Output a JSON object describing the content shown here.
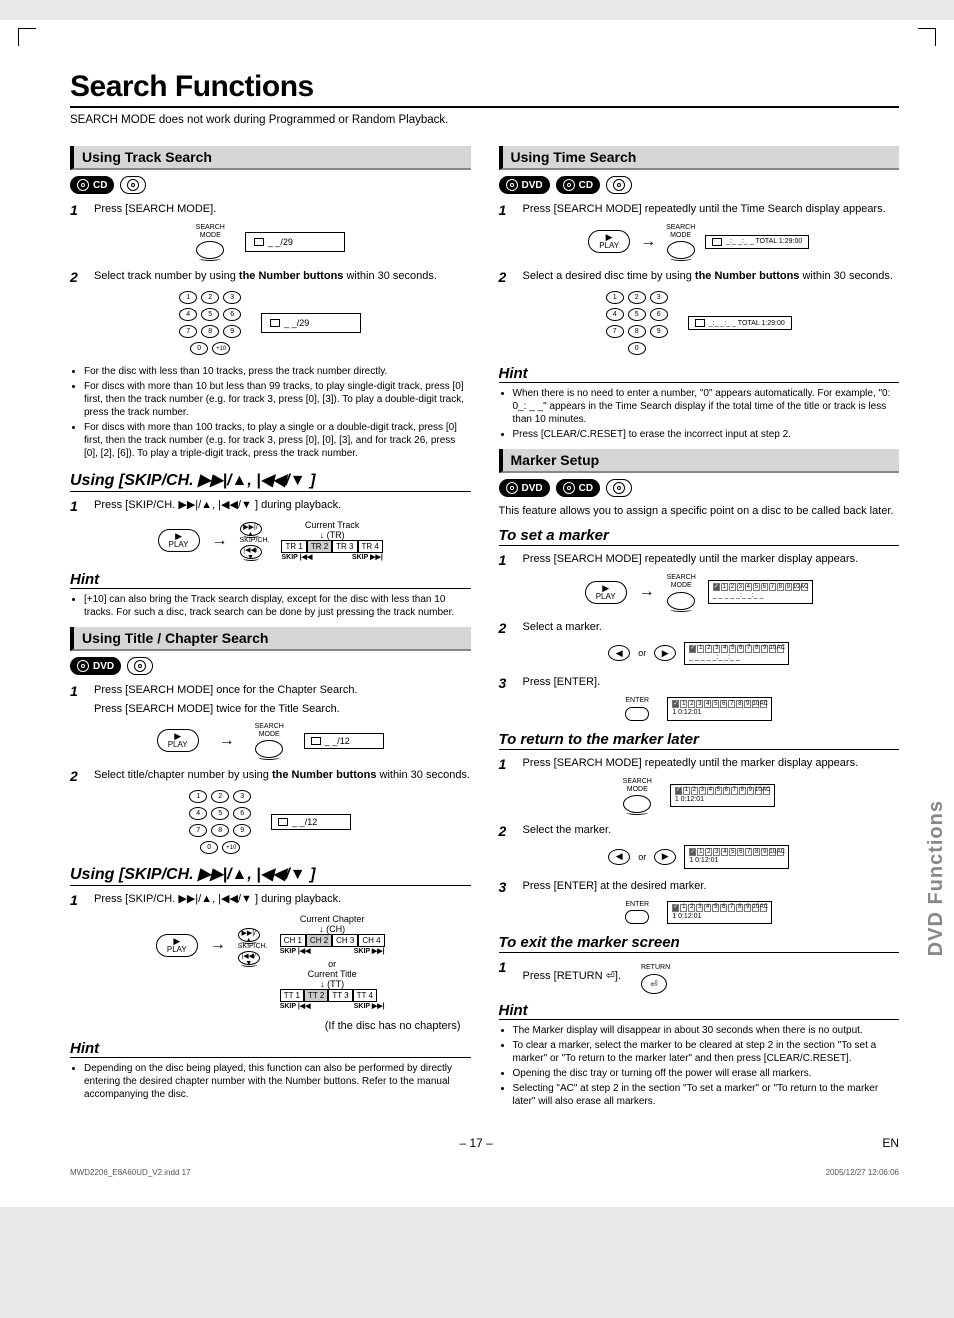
{
  "title": "Search Functions",
  "intro": "SEARCH MODE does not work during Programmed or Random Playback.",
  "left": {
    "track": {
      "header": "Using Track Search",
      "badge": "CD",
      "s1": "Press [SEARCH MODE].",
      "btn1": "SEARCH\nMODE",
      "disp1": "_ _/29",
      "s2a": "Select track number by using ",
      "s2b": "the Number buttons",
      "s2c": " within 30 seconds.",
      "disp2": "_ _/29",
      "b1": "For the disc with less than 10 tracks, press the track number directly.",
      "b2": "For discs with more than 10 but less than 99 tracks, to play single-digit track, press [0] first, then the track number (e.g. for track 3, press [0], [3]). To play a double-digit track, press the track number.",
      "b3": "For discs with more than 100 tracks, to play a single or a double-digit track, press [0] first, then the track number (e.g. for track 3, press [0], [0], [3], and for track 26, press [0], [2], [6]). To play a triple-digit track, press the track number."
    },
    "skip1": {
      "header": "Using [SKIP/CH. ▶▶|/▲, |◀◀/▼ ]",
      "s1": "Press [SKIP/CH. ▶▶|/▲, |◀◀/▼ ] during playback.",
      "play": "PLAY",
      "skipch": "SKIP/CH.",
      "curtrack": "Current Track",
      "tr": "(TR)",
      "tracks": [
        "TR 1",
        "TR 2",
        "TR 3",
        "TR 4"
      ],
      "skipL": "SKIP |◀◀",
      "skipR": "SKIP ▶▶|",
      "hint": "Hint",
      "hb": "[+10] can also bring the Track search display, except for the disc with less than 10 tracks. For such a disc, track search can be done by just pressing the track number."
    },
    "title": {
      "header": "Using Title / Chapter Search",
      "badge": "DVD",
      "s1a": "Press [SEARCH MODE] once for the Chapter Search.",
      "s1b": "Press [SEARCH MODE] twice for the Title Search.",
      "btn": "SEARCH\nMODE",
      "play": "PLAY",
      "disp": "_ _/12",
      "s2a": "Select title/chapter number by using ",
      "s2b": "the Number buttons",
      "s2c": " within 30 seconds.",
      "disp2": "_ _/12"
    },
    "skip2": {
      "header": "Using [SKIP/CH. ▶▶|/▲, |◀◀/▼ ]",
      "s1": "Press [SKIP/CH. ▶▶|/▲, |◀◀/▼ ] during playback.",
      "play": "PLAY",
      "skipch": "SKIP/CH.",
      "curch": "Current Chapter",
      "ch": "(CH)",
      "chapters": [
        "CH 1",
        "CH 2",
        "CH 3",
        "CH 4"
      ],
      "or": "or",
      "curtt": "Current Title",
      "tt": "(TT)",
      "titles": [
        "TT 1",
        "TT 2",
        "TT 3",
        "TT 4"
      ],
      "note": "(If the disc has no chapters)",
      "skipL": "SKIP |◀◀",
      "skipR": "SKIP ▶▶|",
      "hint": "Hint",
      "hb": "Depending on the disc being played, this function can also be performed by directly entering the desired chapter number with the Number buttons. Refer to the manual accompanying the disc."
    }
  },
  "right": {
    "time": {
      "header": "Using Time Search",
      "b1": "DVD",
      "b2": "CD",
      "s1": "Press [SEARCH MODE] repeatedly until the Time Search display appears.",
      "btn": "SEARCH\nMODE",
      "play": "PLAY",
      "disp1": "_:_ _:_ _  TOTAL 1:29:00",
      "s2a": "Select a desired disc time by using ",
      "s2b": "the Number buttons",
      "s2c": " within 30 seconds.",
      "disp2": "_:_ _:_ _  TOTAL 1:29:00",
      "hint": "Hint",
      "hb1": "When there is no need to enter a number, \"0\" appears automatically. For example, \"0: 0_: _ _\" appears in the Time Search display if the total time of the title or track is less than 10 minutes.",
      "hb2": "Press [CLEAR/C.RESET] to erase the incorrect input at step 2."
    },
    "marker": {
      "header": "Marker Setup",
      "b1": "DVD",
      "b2": "CD",
      "intro": "This feature allows you to assign a specific point on a disc to be called back later.",
      "set": "To set a marker",
      "ss1": "Press [SEARCH MODE] repeatedly until the marker display appears.",
      "btn": "SEARCH\nMODE",
      "play": "PLAY",
      "ss2": "Select a marker.",
      "or": "or",
      "ss3": "Press [ENTER].",
      "enter": "ENTER",
      "mdisp": "1  0:12:01",
      "ret": "To return to the marker later",
      "rs1": "Press [SEARCH MODE] repeatedly until the marker display appears.",
      "rs2": "Select the marker.",
      "rs3": "Press [ENTER] at the desired marker.",
      "exit": "To exit the marker screen",
      "es1": "Press [RETURN ⏎].",
      "return": "RETURN",
      "hint": "Hint",
      "hb1": "The Marker display will disappear in about 30 seconds when there is no output.",
      "hb2": "To clear a marker, select the marker to be cleared at step 2 in the section \"To set a marker\" or \"To return to the marker later\" and then press [CLEAR/C.RESET].",
      "hb3": "Opening the disc tray or turning off the power will erase all markers.",
      "hb4": "Selecting \"AC\" at step 2 in the section \"To set a marker\" or \"To return to the marker later\" will also erase all markers."
    }
  },
  "sidetab": "DVD Functions",
  "pageno": "– 17 –",
  "lang": "EN",
  "meta_l": "MWD2206_E8A60UD_V2.indd   17",
  "meta_r": "2005/12/27   12:06:06"
}
